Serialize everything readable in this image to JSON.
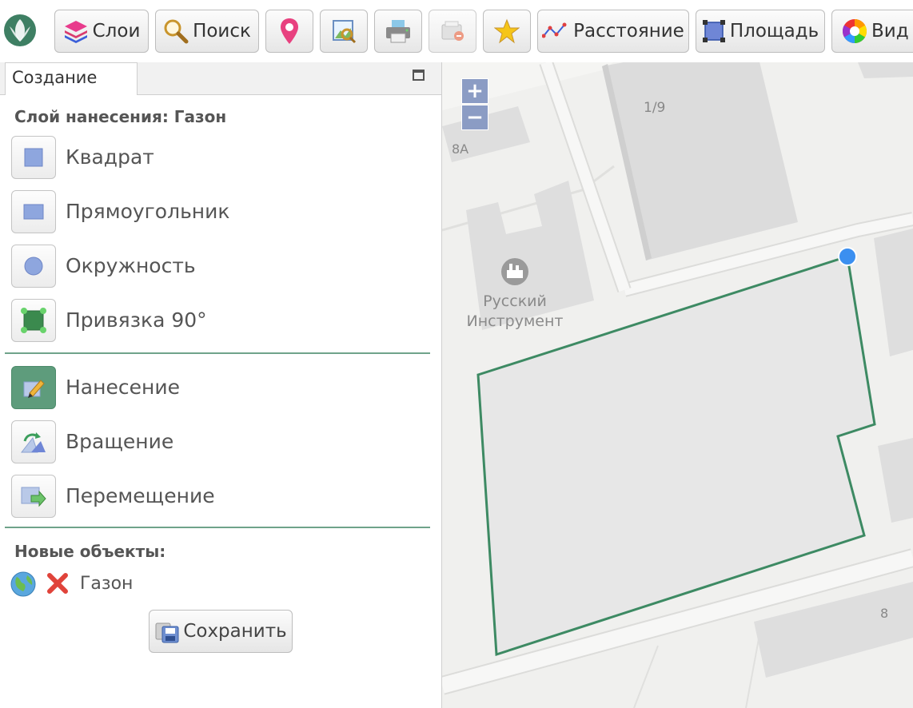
{
  "toolbar": {
    "layers_label": "Слои",
    "search_label": "Поиск",
    "distance_label": "Расстояние",
    "area_label": "Площадь",
    "view_label": "Вид к"
  },
  "panel": {
    "tab_label": "Создание",
    "layer_heading": "Слой нанесения: Газон",
    "tools": [
      "Квадрат",
      "Прямоугольник",
      "Окружность",
      "Привязка 90°"
    ],
    "actions": [
      "Нанесение",
      "Вращение",
      "Перемещение"
    ],
    "new_objects_heading": "Новые объекты:",
    "new_object_name": "Газон",
    "save_label": "Сохранить"
  },
  "map": {
    "zoom_in": "+",
    "zoom_out": "−",
    "labels": {
      "b_1_9": "1/9",
      "b_8a": "8А",
      "poi_line1": "Русский",
      "poi_line2": "Инструмент",
      "b_8": "8"
    },
    "polygon_color": "#3d8a63",
    "vertex_color": "#3b8ff0"
  }
}
